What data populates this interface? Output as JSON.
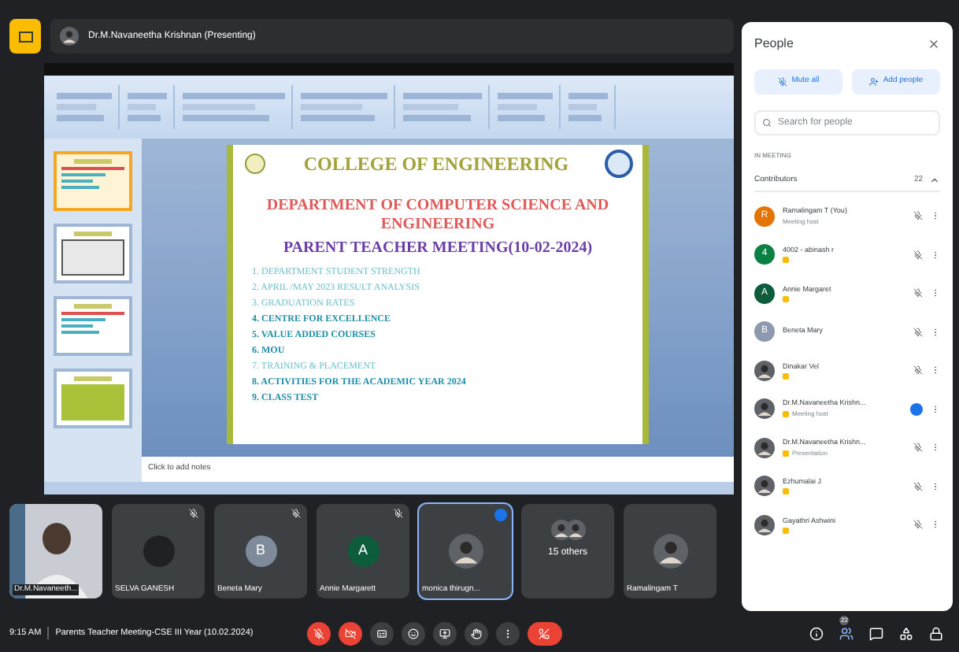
{
  "presenter_bar": {
    "label": "Dr.M.Navaneetha Krishnan (Presenting)"
  },
  "shared_screen": {
    "thumbnails": [
      {
        "selected": true
      },
      {
        "selected": false
      },
      {
        "selected": false
      },
      {
        "selected": false
      }
    ],
    "slide": {
      "title": "COLLEGE OF ENGINEERING",
      "department": "DEPARTMENT OF  COMPUTER SCIENCE AND ENGINEERING",
      "meeting": "PARENT TEACHER  MEETING(10-02-2024)",
      "agenda": [
        {
          "number": "1.",
          "text": "DEPARTMENT STUDENT STRENGTH",
          "bold": false
        },
        {
          "number": "2.",
          "text": "APRIL /MAY 2023 RESULT ANALYSIS",
          "bold": false
        },
        {
          "number": "3.",
          "text": "GRADUATION RATES",
          "bold": false
        },
        {
          "number": "4.",
          "text": "CENTRE FOR EXCELLENCE",
          "bold": true
        },
        {
          "number": "5.",
          "text": "VALUE ADDED COURSES",
          "bold": true
        },
        {
          "number": "6.",
          "text": "MOU",
          "bold": true
        },
        {
          "number": "7.",
          "text": "TRAINING & PLACEMENT",
          "bold": false
        },
        {
          "number": "8.",
          "text": "ACTIVITIES FOR THE ACADEMIC YEAR 2024",
          "bold": true
        },
        {
          "number": "9.",
          "text": "CLASS TEST",
          "bold": true
        }
      ]
    },
    "notes_placeholder": "Click to add notes"
  },
  "tiles": [
    {
      "kind": "video",
      "name": "Dr.M.Navaneeth...",
      "muted": false,
      "speaking": false
    },
    {
      "kind": "avatar",
      "name": "SELVA GANESH",
      "color": "#202124",
      "muted": true,
      "speaking": false
    },
    {
      "kind": "avatar",
      "name": "Beneta Mary",
      "letter": "B",
      "color": "#7f8a9a",
      "muted": true,
      "speaking": false
    },
    {
      "kind": "avatar",
      "name": "Annie Margarett",
      "letter": "A",
      "color": "#0d5c3c",
      "muted": true,
      "speaking": false
    },
    {
      "name": "monica thirugn...",
      "muted": false,
      "speaking": true
    },
    {
      "kind": "group",
      "name": "15 others",
      "muted": false,
      "speaking": false
    },
    {
      "name": "Ramalingam T",
      "muted": false,
      "speaking": false
    }
  ],
  "bottom_bar": {
    "time": "9:15 AM",
    "meeting_title": "Parents Teacher Meeting-CSE III Year (10.02.2024)",
    "controls": [
      {
        "kind": "mic",
        "off": true
      },
      {
        "kind": "camera",
        "off": true
      },
      {
        "kind": "captions",
        "off": false
      },
      {
        "kind": "emoji",
        "off": false
      },
      {
        "kind": "present",
        "off": false
      },
      {
        "kind": "hand",
        "off": false
      },
      {
        "kind": "more",
        "off": false
      },
      {
        "kind": "end"
      }
    ],
    "people_count": "22"
  },
  "people_panel": {
    "title": "People",
    "buttons": [
      "Mute all",
      "Add people"
    ],
    "search_placeholder": "Search for people",
    "section": "IN MEETING",
    "group": {
      "label": "Contributors",
      "count": "22",
      "expanded": true
    },
    "participants": [
      {
        "name": "Ramalingam T (You)",
        "role": "Meeting host",
        "kind": "letter",
        "letter": "R",
        "color": "#e37400",
        "badge": false,
        "muted": true,
        "speaking": false
      },
      {
        "name": "4002 - abinash r",
        "kind": "letter",
        "letter": "4",
        "color": "#0b8043",
        "badge": true,
        "muted": true,
        "speaking": false
      },
      {
        "name": "Annie Margaret",
        "kind": "letter",
        "letter": "A",
        "color": "#0d5c3c",
        "badge": true,
        "muted": true,
        "speaking": false
      },
      {
        "name": "Beneta Mary",
        "kind": "letter",
        "letter": "B",
        "color": "#8d99ae",
        "badge": false,
        "muted": true,
        "speaking": false
      },
      {
        "name": "Dinakar Vel",
        "badge": true,
        "muted": true,
        "speaking": false
      },
      {
        "name": "Dr.M.Navaneetha Krishn...",
        "role": "Meeting host",
        "badge": true,
        "muted": false,
        "speaking": true
      },
      {
        "name": "Dr.M.Navaneetha Krishn...",
        "role": "Presentation",
        "badge": true,
        "muted": true,
        "speaking": false
      },
      {
        "name": "Ezhumalai J",
        "badge": true,
        "muted": true,
        "speaking": false
      },
      {
        "name": "Gayathri Ashwini",
        "badge": true,
        "muted": true,
        "speaking": false
      }
    ]
  }
}
